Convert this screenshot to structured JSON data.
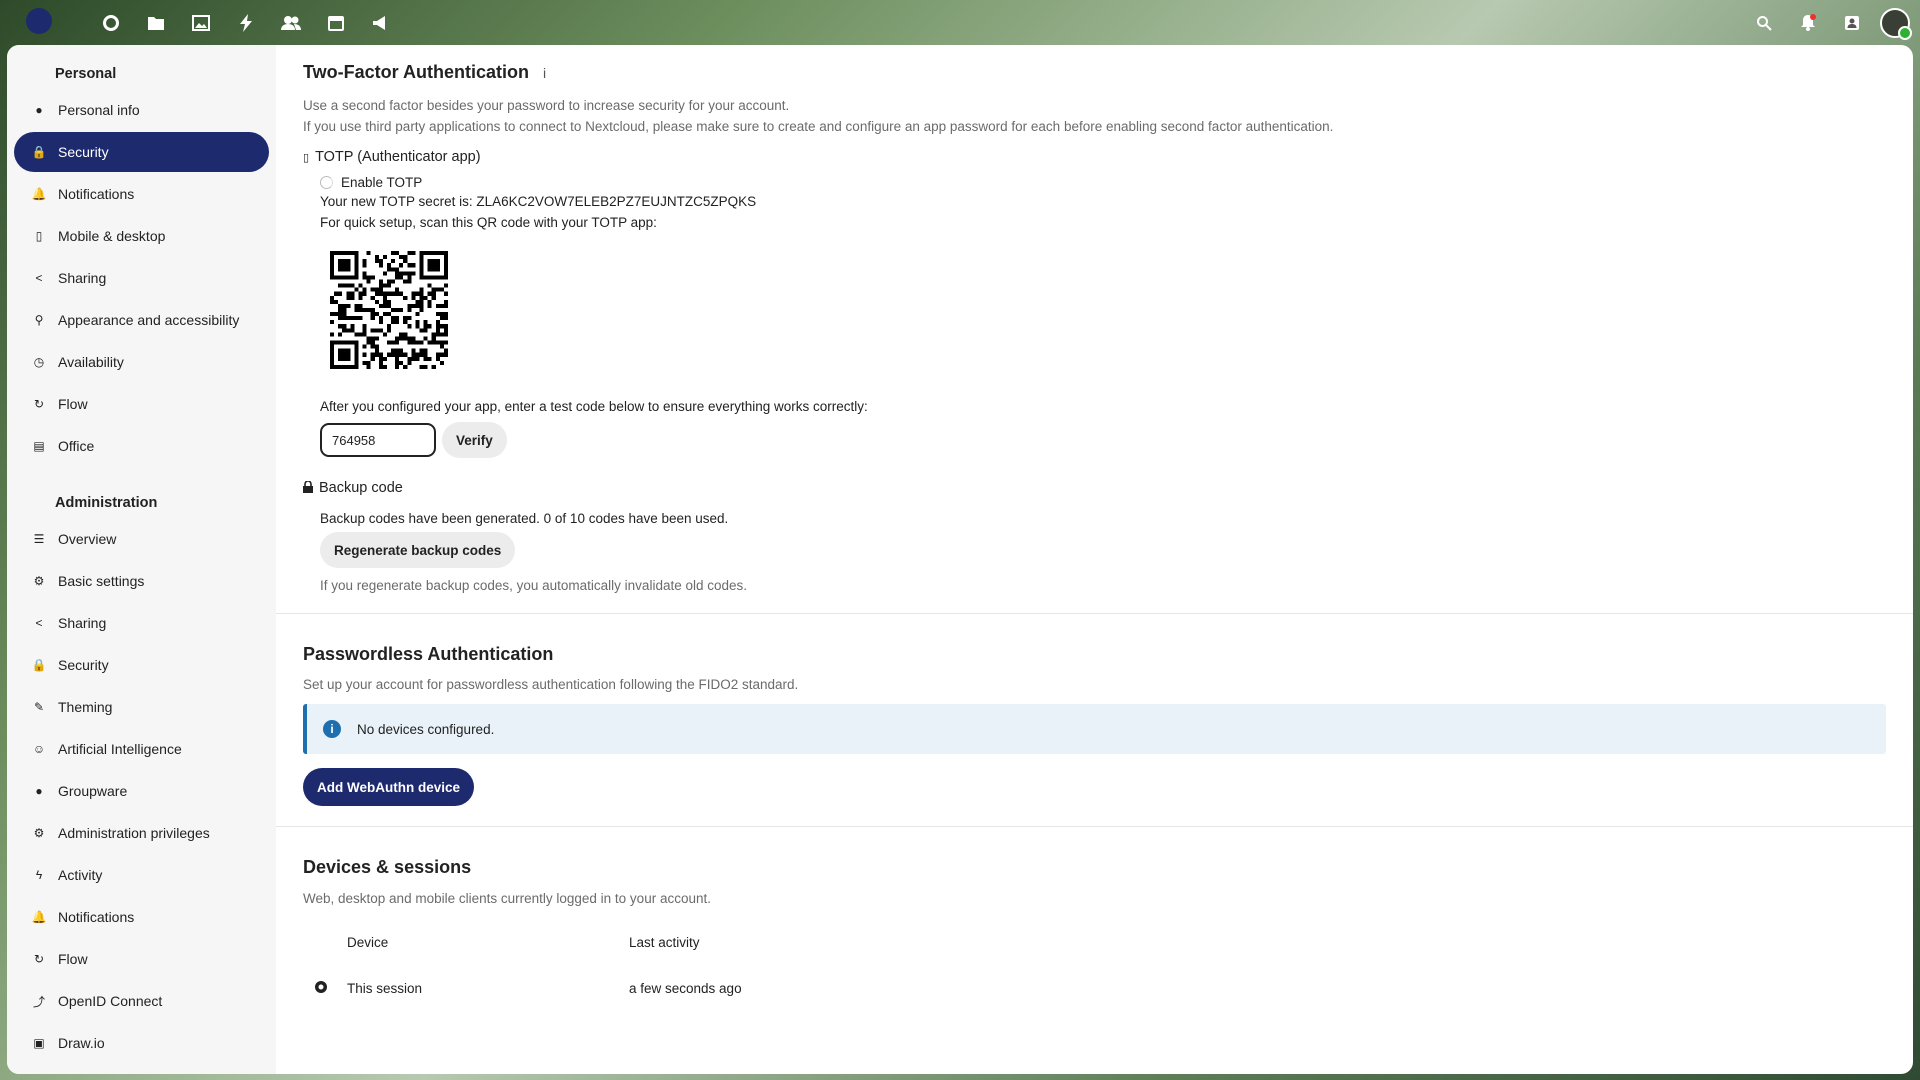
{
  "topbar": {
    "apps": [
      {
        "icon": "dashboard-icon"
      },
      {
        "icon": "files-icon"
      },
      {
        "icon": "photos-icon"
      },
      {
        "icon": "activity-icon"
      },
      {
        "icon": "contacts-icon"
      },
      {
        "icon": "calendar-icon"
      },
      {
        "icon": "announcements-icon"
      }
    ],
    "right_icons": [
      "search-icon",
      "notifications-icon",
      "contacts-menu-icon"
    ]
  },
  "sidebar": {
    "personal_caption": "Personal",
    "personal_items": [
      {
        "label": "Personal info",
        "icon": "user-icon"
      },
      {
        "label": "Security",
        "icon": "lock-icon",
        "active": true
      },
      {
        "label": "Notifications",
        "icon": "bell-icon"
      },
      {
        "label": "Mobile & desktop",
        "icon": "phone-icon"
      },
      {
        "label": "Sharing",
        "icon": "share-icon"
      },
      {
        "label": "Appearance and accessibility",
        "icon": "accessibility-icon"
      },
      {
        "label": "Availability",
        "icon": "clock-icon"
      },
      {
        "label": "Flow",
        "icon": "flow-icon"
      },
      {
        "label": "Office",
        "icon": "document-icon"
      }
    ],
    "admin_caption": "Administration",
    "admin_items": [
      {
        "label": "Overview",
        "icon": "list-icon"
      },
      {
        "label": "Basic settings",
        "icon": "gear-icon"
      },
      {
        "label": "Sharing",
        "icon": "share-icon"
      },
      {
        "label": "Security",
        "icon": "lock-icon"
      },
      {
        "label": "Theming",
        "icon": "brush-icon"
      },
      {
        "label": "Artificial Intelligence",
        "icon": "robot-icon"
      },
      {
        "label": "Groupware",
        "icon": "user-icon"
      },
      {
        "label": "Administration privileges",
        "icon": "gear-icon"
      },
      {
        "label": "Activity",
        "icon": "activity-icon"
      },
      {
        "label": "Notifications",
        "icon": "bell-icon"
      },
      {
        "label": "Flow",
        "icon": "flow-icon"
      },
      {
        "label": "OpenID Connect",
        "icon": "openid-icon"
      },
      {
        "label": "Draw.io",
        "icon": "drawio-icon"
      }
    ]
  },
  "twofa": {
    "title": "Two-Factor Authentication",
    "info_icon": "i",
    "desc1": "Use a second factor besides your password to increase security for your account.",
    "desc2": "If you use third party applications to connect to Nextcloud, please make sure to create and configure an app password for each before enabling second factor authentication.",
    "totp_title": "TOTP (Authenticator app)",
    "enable_label": "Enable TOTP",
    "secret_text": "Your new TOTP secret is: ZLA6KC2VOW7ELEB2PZ7EUJNTZC5ZPQKS",
    "scan_text": "For quick setup, scan this QR code with your TOTP app:",
    "verify_prompt": "After you configured your app, enter a test code below to ensure everything works correctly:",
    "code_value": "764958",
    "verify_label": "Verify",
    "backup_title": "Backup code",
    "backup_status": "Backup codes have been generated. 0 of 10 codes have been used.",
    "regenerate_label": "Regenerate backup codes",
    "backup_hint": "If you regenerate backup codes, you automatically invalidate old codes."
  },
  "passwordless": {
    "title": "Passwordless Authentication",
    "desc": "Set up your account for passwordless authentication following the FIDO2 standard.",
    "note": "No devices configured.",
    "add_label": "Add WebAuthn device"
  },
  "sessions": {
    "title": "Devices & sessions",
    "desc": "Web, desktop and mobile clients currently logged in to your account.",
    "col_device": "Device",
    "col_activity": "Last activity",
    "rows": [
      {
        "device": "This session",
        "activity": "a few seconds ago"
      }
    ]
  },
  "colors": {
    "primary": "#1e2a6e",
    "info": "#1e6fb0"
  }
}
